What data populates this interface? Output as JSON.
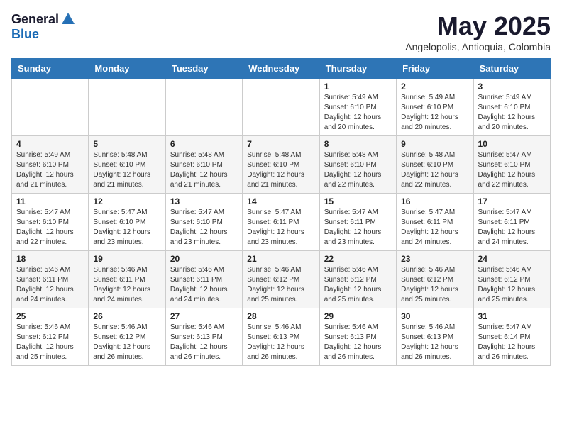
{
  "logo": {
    "general": "General",
    "blue": "Blue"
  },
  "title": "May 2025",
  "subtitle": "Angelopolis, Antioquia, Colombia",
  "days_header": [
    "Sunday",
    "Monday",
    "Tuesday",
    "Wednesday",
    "Thursday",
    "Friday",
    "Saturday"
  ],
  "weeks": [
    [
      {
        "day": "",
        "info": ""
      },
      {
        "day": "",
        "info": ""
      },
      {
        "day": "",
        "info": ""
      },
      {
        "day": "",
        "info": ""
      },
      {
        "day": "1",
        "info": "Sunrise: 5:49 AM\nSunset: 6:10 PM\nDaylight: 12 hours\nand 20 minutes."
      },
      {
        "day": "2",
        "info": "Sunrise: 5:49 AM\nSunset: 6:10 PM\nDaylight: 12 hours\nand 20 minutes."
      },
      {
        "day": "3",
        "info": "Sunrise: 5:49 AM\nSunset: 6:10 PM\nDaylight: 12 hours\nand 20 minutes."
      }
    ],
    [
      {
        "day": "4",
        "info": "Sunrise: 5:49 AM\nSunset: 6:10 PM\nDaylight: 12 hours\nand 21 minutes."
      },
      {
        "day": "5",
        "info": "Sunrise: 5:48 AM\nSunset: 6:10 PM\nDaylight: 12 hours\nand 21 minutes."
      },
      {
        "day": "6",
        "info": "Sunrise: 5:48 AM\nSunset: 6:10 PM\nDaylight: 12 hours\nand 21 minutes."
      },
      {
        "day": "7",
        "info": "Sunrise: 5:48 AM\nSunset: 6:10 PM\nDaylight: 12 hours\nand 21 minutes."
      },
      {
        "day": "8",
        "info": "Sunrise: 5:48 AM\nSunset: 6:10 PM\nDaylight: 12 hours\nand 22 minutes."
      },
      {
        "day": "9",
        "info": "Sunrise: 5:48 AM\nSunset: 6:10 PM\nDaylight: 12 hours\nand 22 minutes."
      },
      {
        "day": "10",
        "info": "Sunrise: 5:47 AM\nSunset: 6:10 PM\nDaylight: 12 hours\nand 22 minutes."
      }
    ],
    [
      {
        "day": "11",
        "info": "Sunrise: 5:47 AM\nSunset: 6:10 PM\nDaylight: 12 hours\nand 22 minutes."
      },
      {
        "day": "12",
        "info": "Sunrise: 5:47 AM\nSunset: 6:10 PM\nDaylight: 12 hours\nand 23 minutes."
      },
      {
        "day": "13",
        "info": "Sunrise: 5:47 AM\nSunset: 6:10 PM\nDaylight: 12 hours\nand 23 minutes."
      },
      {
        "day": "14",
        "info": "Sunrise: 5:47 AM\nSunset: 6:11 PM\nDaylight: 12 hours\nand 23 minutes."
      },
      {
        "day": "15",
        "info": "Sunrise: 5:47 AM\nSunset: 6:11 PM\nDaylight: 12 hours\nand 23 minutes."
      },
      {
        "day": "16",
        "info": "Sunrise: 5:47 AM\nSunset: 6:11 PM\nDaylight: 12 hours\nand 24 minutes."
      },
      {
        "day": "17",
        "info": "Sunrise: 5:47 AM\nSunset: 6:11 PM\nDaylight: 12 hours\nand 24 minutes."
      }
    ],
    [
      {
        "day": "18",
        "info": "Sunrise: 5:46 AM\nSunset: 6:11 PM\nDaylight: 12 hours\nand 24 minutes."
      },
      {
        "day": "19",
        "info": "Sunrise: 5:46 AM\nSunset: 6:11 PM\nDaylight: 12 hours\nand 24 minutes."
      },
      {
        "day": "20",
        "info": "Sunrise: 5:46 AM\nSunset: 6:11 PM\nDaylight: 12 hours\nand 24 minutes."
      },
      {
        "day": "21",
        "info": "Sunrise: 5:46 AM\nSunset: 6:12 PM\nDaylight: 12 hours\nand 25 minutes."
      },
      {
        "day": "22",
        "info": "Sunrise: 5:46 AM\nSunset: 6:12 PM\nDaylight: 12 hours\nand 25 minutes."
      },
      {
        "day": "23",
        "info": "Sunrise: 5:46 AM\nSunset: 6:12 PM\nDaylight: 12 hours\nand 25 minutes."
      },
      {
        "day": "24",
        "info": "Sunrise: 5:46 AM\nSunset: 6:12 PM\nDaylight: 12 hours\nand 25 minutes."
      }
    ],
    [
      {
        "day": "25",
        "info": "Sunrise: 5:46 AM\nSunset: 6:12 PM\nDaylight: 12 hours\nand 25 minutes."
      },
      {
        "day": "26",
        "info": "Sunrise: 5:46 AM\nSunset: 6:12 PM\nDaylight: 12 hours\nand 26 minutes."
      },
      {
        "day": "27",
        "info": "Sunrise: 5:46 AM\nSunset: 6:13 PM\nDaylight: 12 hours\nand 26 minutes."
      },
      {
        "day": "28",
        "info": "Sunrise: 5:46 AM\nSunset: 6:13 PM\nDaylight: 12 hours\nand 26 minutes."
      },
      {
        "day": "29",
        "info": "Sunrise: 5:46 AM\nSunset: 6:13 PM\nDaylight: 12 hours\nand 26 minutes."
      },
      {
        "day": "30",
        "info": "Sunrise: 5:46 AM\nSunset: 6:13 PM\nDaylight: 12 hours\nand 26 minutes."
      },
      {
        "day": "31",
        "info": "Sunrise: 5:47 AM\nSunset: 6:14 PM\nDaylight: 12 hours\nand 26 minutes."
      }
    ]
  ]
}
